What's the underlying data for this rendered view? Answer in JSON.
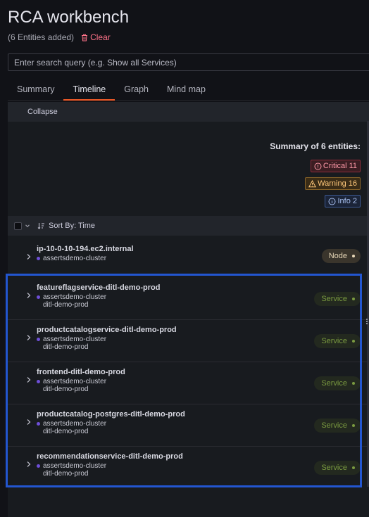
{
  "header": {
    "title": "RCA workbench",
    "entities_added": "(6 Entities added)",
    "clear_label": "Clear"
  },
  "search": {
    "placeholder": "Enter search query (e.g. Show all Services)"
  },
  "tabs": [
    {
      "label": "Summary",
      "active": false
    },
    {
      "label": "Timeline",
      "active": true
    },
    {
      "label": "Graph",
      "active": false
    },
    {
      "label": "Mind map",
      "active": false
    }
  ],
  "toolbar": {
    "collapse_label": "Collapse"
  },
  "summary": {
    "title": "Summary of 6 entities:",
    "critical_label": "Critical 11",
    "warning_label": "Warning 16",
    "info_label": "Info 2"
  },
  "sort": {
    "label": "Sort By: Time"
  },
  "entities": [
    {
      "name": "ip-10-0-10-194.ec2.internal",
      "cluster": "assertsdemo-cluster",
      "env": "",
      "type": "Node"
    },
    {
      "name": "featureflagservice-ditl-demo-prod",
      "cluster": "assertsdemo-cluster",
      "env": "ditl-demo-prod",
      "type": "Service"
    },
    {
      "name": "productcatalogservice-ditl-demo-prod",
      "cluster": "assertsdemo-cluster",
      "env": "ditl-demo-prod",
      "type": "Service"
    },
    {
      "name": "frontend-ditl-demo-prod",
      "cluster": "assertsdemo-cluster",
      "env": "ditl-demo-prod",
      "type": "Service"
    },
    {
      "name": "productcatalog-postgres-ditl-demo-prod",
      "cluster": "assertsdemo-cluster",
      "env": "ditl-demo-prod",
      "type": "Service"
    },
    {
      "name": "recommendationservice-ditl-demo-prod",
      "cluster": "assertsdemo-cluster",
      "env": "ditl-demo-prod",
      "type": "Service"
    }
  ],
  "colors": {
    "accent_tab": "#f05a28",
    "highlight_border": "#2356d0",
    "cluster_dot": "#6e4fd8"
  }
}
